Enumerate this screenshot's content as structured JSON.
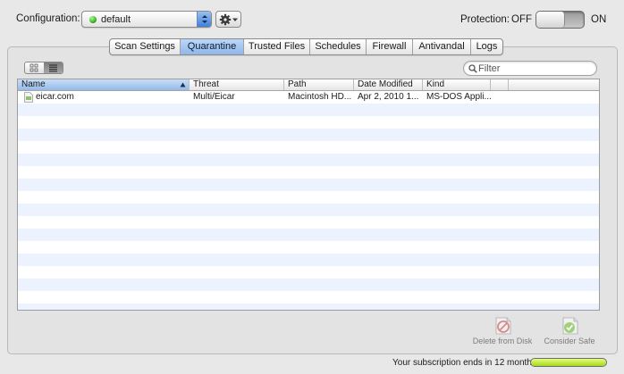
{
  "config": {
    "label": "Configuration:",
    "value": "default",
    "status_color": "#2fae1a"
  },
  "protection": {
    "label": "Protection:",
    "off_label": "OFF",
    "on_label": "ON",
    "state": "off"
  },
  "tabs": [
    {
      "label": "Scan Settings",
      "active": false
    },
    {
      "label": "Quarantine",
      "active": true
    },
    {
      "label": "Trusted Files",
      "active": false
    },
    {
      "label": "Schedules",
      "active": false
    },
    {
      "label": "Firewall",
      "active": false
    },
    {
      "label": "Antivandal",
      "active": false
    },
    {
      "label": "Logs",
      "active": false
    }
  ],
  "view_mode": "list",
  "filter": {
    "placeholder": "Filter",
    "value": ""
  },
  "table": {
    "columns": [
      {
        "label": "Name",
        "sorted": "ascending"
      },
      {
        "label": "Threat"
      },
      {
        "label": "Path"
      },
      {
        "label": "Date Modified"
      },
      {
        "label": "Kind"
      },
      {
        "label": ""
      },
      {
        "label": ""
      }
    ],
    "rows": [
      {
        "name": "eicar.com",
        "threat": "Multi/Eicar",
        "path": "Macintosh HD...",
        "date": "Apr 2, 2010 1...",
        "kind": "MS-DOS Appli..."
      }
    ]
  },
  "actions": {
    "delete_label": "Delete from Disk",
    "safe_label": "Consider Safe"
  },
  "subscription": {
    "text": "Your subscription ends in 12 months",
    "level": 1.0,
    "bar_color": "#a6da1b"
  }
}
